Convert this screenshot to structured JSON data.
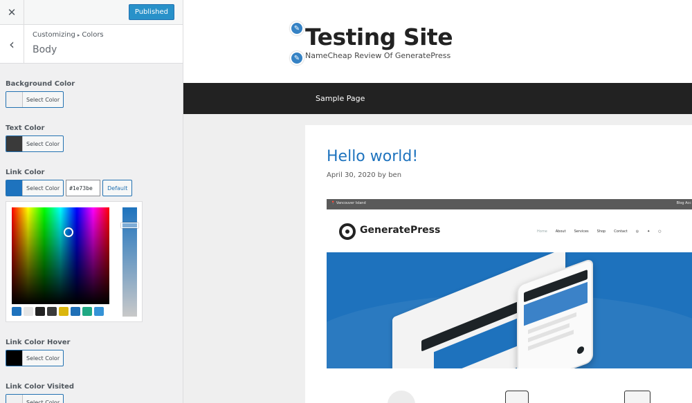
{
  "topbar": {
    "close_glyph": "✕",
    "publish_label": "Published"
  },
  "section": {
    "back_glyph": "‹",
    "breadcrumb": {
      "parent": "Customizing",
      "separator": "▸",
      "current": "Colors"
    },
    "title": "Body"
  },
  "controls": [
    {
      "label": "Background Color",
      "button": "Select Color",
      "swatch": "#f0f0f1"
    },
    {
      "label": "Text Color",
      "button": "Select Color",
      "swatch": "#3a3a3a"
    },
    {
      "label": "Link Color",
      "button": "Select Color",
      "swatch": "#1e73be",
      "hex_value": "#1e73be",
      "default_label": "Default",
      "expanded": true
    },
    {
      "label": "Link Color Hover",
      "button": "Select Color",
      "swatch": "#000000"
    },
    {
      "label": "Link Color Visited",
      "button": "Select Color",
      "swatch": "#f0f0f1"
    }
  ],
  "picker": {
    "palette": [
      "#1e72bd",
      "#e5e5e5",
      "#222222",
      "#3a3a3a",
      "#dbb60d",
      "#1f6fb6",
      "#1fa883",
      "#3593d6"
    ]
  },
  "colors": {
    "accent": "#2891c9",
    "link": "#1e73be",
    "nav_bg": "#222222"
  },
  "preview": {
    "site_title": "Testing Site",
    "tagline": "NameCheap Review Of GeneratePress",
    "pencil_icon": "pencil-icon",
    "nav": {
      "items": [
        "Sample Page"
      ]
    },
    "post": {
      "title": "Hello world!",
      "meta": "April 30, 2020 by ben"
    },
    "embed": {
      "location": "📍 Vancouver Island",
      "top_links": "Blog  Acc",
      "logo_text": "GeneratePress",
      "menu": [
        "Home",
        "About",
        "Services",
        "Shop",
        "Contact",
        "◎",
        "✦",
        "○"
      ]
    }
  }
}
